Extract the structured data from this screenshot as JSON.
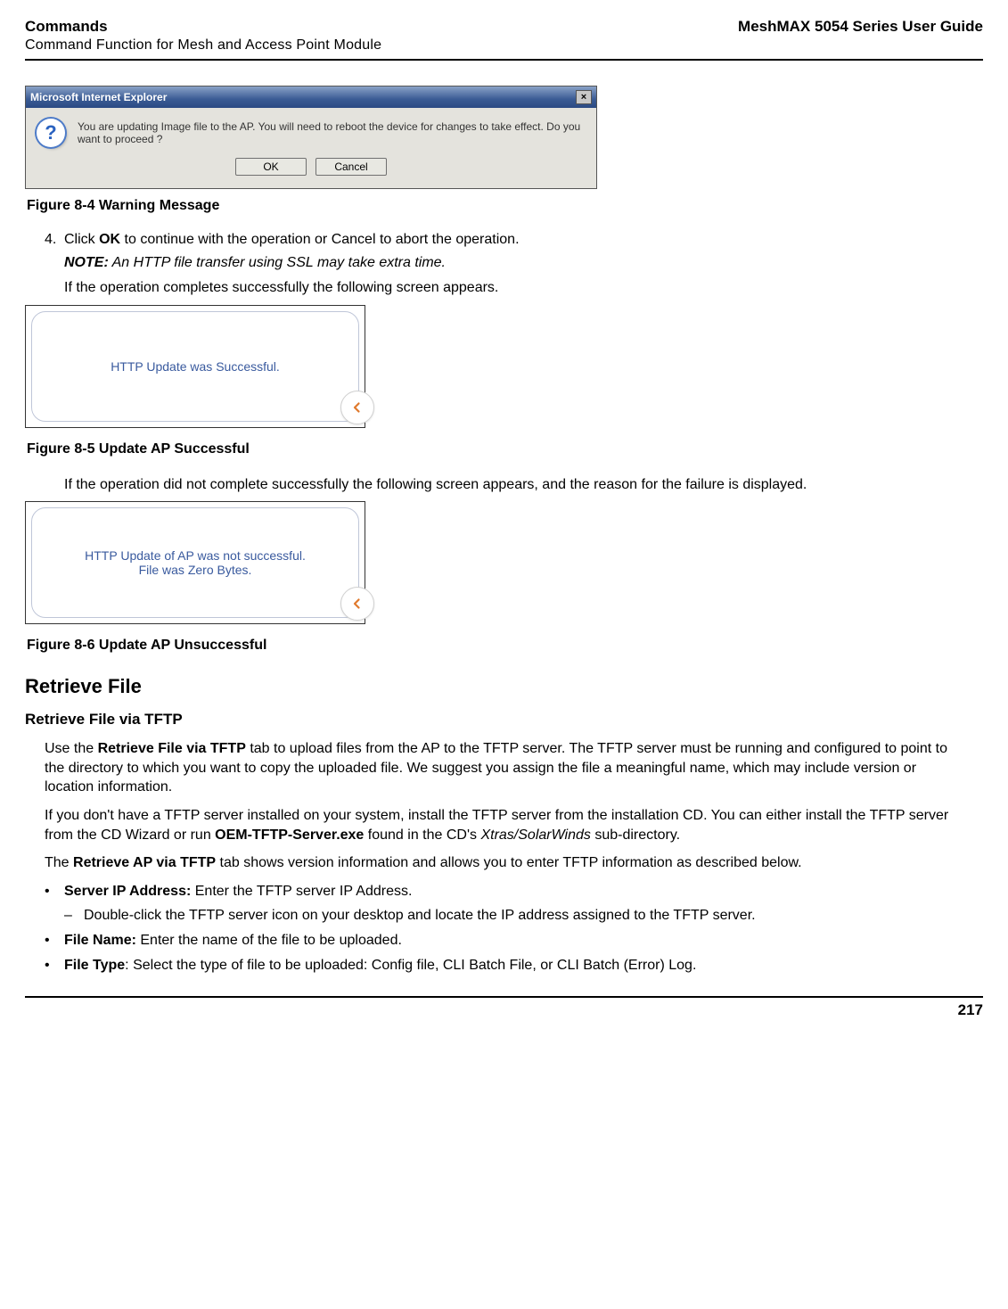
{
  "header": {
    "left_title": "Commands",
    "left_subtitle": "Command Function for Mesh and Access Point Module",
    "right_title": "MeshMAX 5054 Series User Guide"
  },
  "dialog": {
    "titlebar": "Microsoft Internet Explorer",
    "close_glyph": "×",
    "icon_glyph": "?",
    "message": "You are updating Image file to the AP. You will need to reboot the device for changes to take effect. Do you want to proceed ?",
    "ok_label": "OK",
    "cancel_label": "Cancel"
  },
  "fig84_caption": "Figure 8-4 Warning Message",
  "step4": {
    "num": "4.",
    "pre": "Click ",
    "bold": "OK",
    "post": " to continue with the operation or Cancel to abort the operation."
  },
  "note": {
    "label": "NOTE:",
    "text": " An HTTP file transfer using SSL may take extra time."
  },
  "after_note": "If the operation completes successfully the following screen appears.",
  "status_success": "HTTP Update was Successful.",
  "fig85_caption": "Figure 8-5 Update AP Successful",
  "after_success": "If the operation did not complete successfully the following screen appears, and the reason for the failure is displayed.",
  "status_fail_line1": "HTTP Update of AP was not successful.",
  "status_fail_line2": "File was Zero Bytes.",
  "fig86_caption": "Figure 8-6 Update AP Unsuccessful",
  "h2_retrieve": "Retrieve File",
  "h3_retrieve_tftp": "Retrieve File via TFTP",
  "para1": {
    "pre": "Use the ",
    "b1": "Retrieve File via TFTP",
    "post": " tab to upload files from the AP to the TFTP server. The TFTP server must be running and configured to point to the directory to which you want to copy the uploaded file. We suggest you assign the file a meaningful name, which may include version or location information."
  },
  "para2": {
    "pre": "If you don't have a TFTP server installed on your system, install the TFTP server from the installation CD. You can either install the TFTP server from the CD Wizard or run ",
    "b1": "OEM-TFTP-Server.exe",
    "mid": " found in the CD's ",
    "i1": "Xtras/SolarWinds",
    "post": " sub-directory."
  },
  "para3": {
    "pre": "The ",
    "b1": "Retrieve AP via TFTP",
    "post": " tab shows version information and allows you to enter TFTP information as described below."
  },
  "bullets": {
    "b1_dot": "•",
    "b1_bold": "Server IP Address:",
    "b1_text": " Enter the TFTP server IP Address.",
    "b1_sub_dash": "–",
    "b1_sub_text": "Double-click the TFTP server icon on your desktop and locate the IP address assigned to the TFTP server.",
    "b2_dot": "•",
    "b2_bold": "File Name:",
    "b2_text": " Enter the name of the file to be uploaded.",
    "b3_dot": "•",
    "b3_bold": "File Type",
    "b3_text": ": Select the type of file to be uploaded: Config file, CLI Batch File, or CLI Batch (Error) Log."
  },
  "page_number": "217"
}
